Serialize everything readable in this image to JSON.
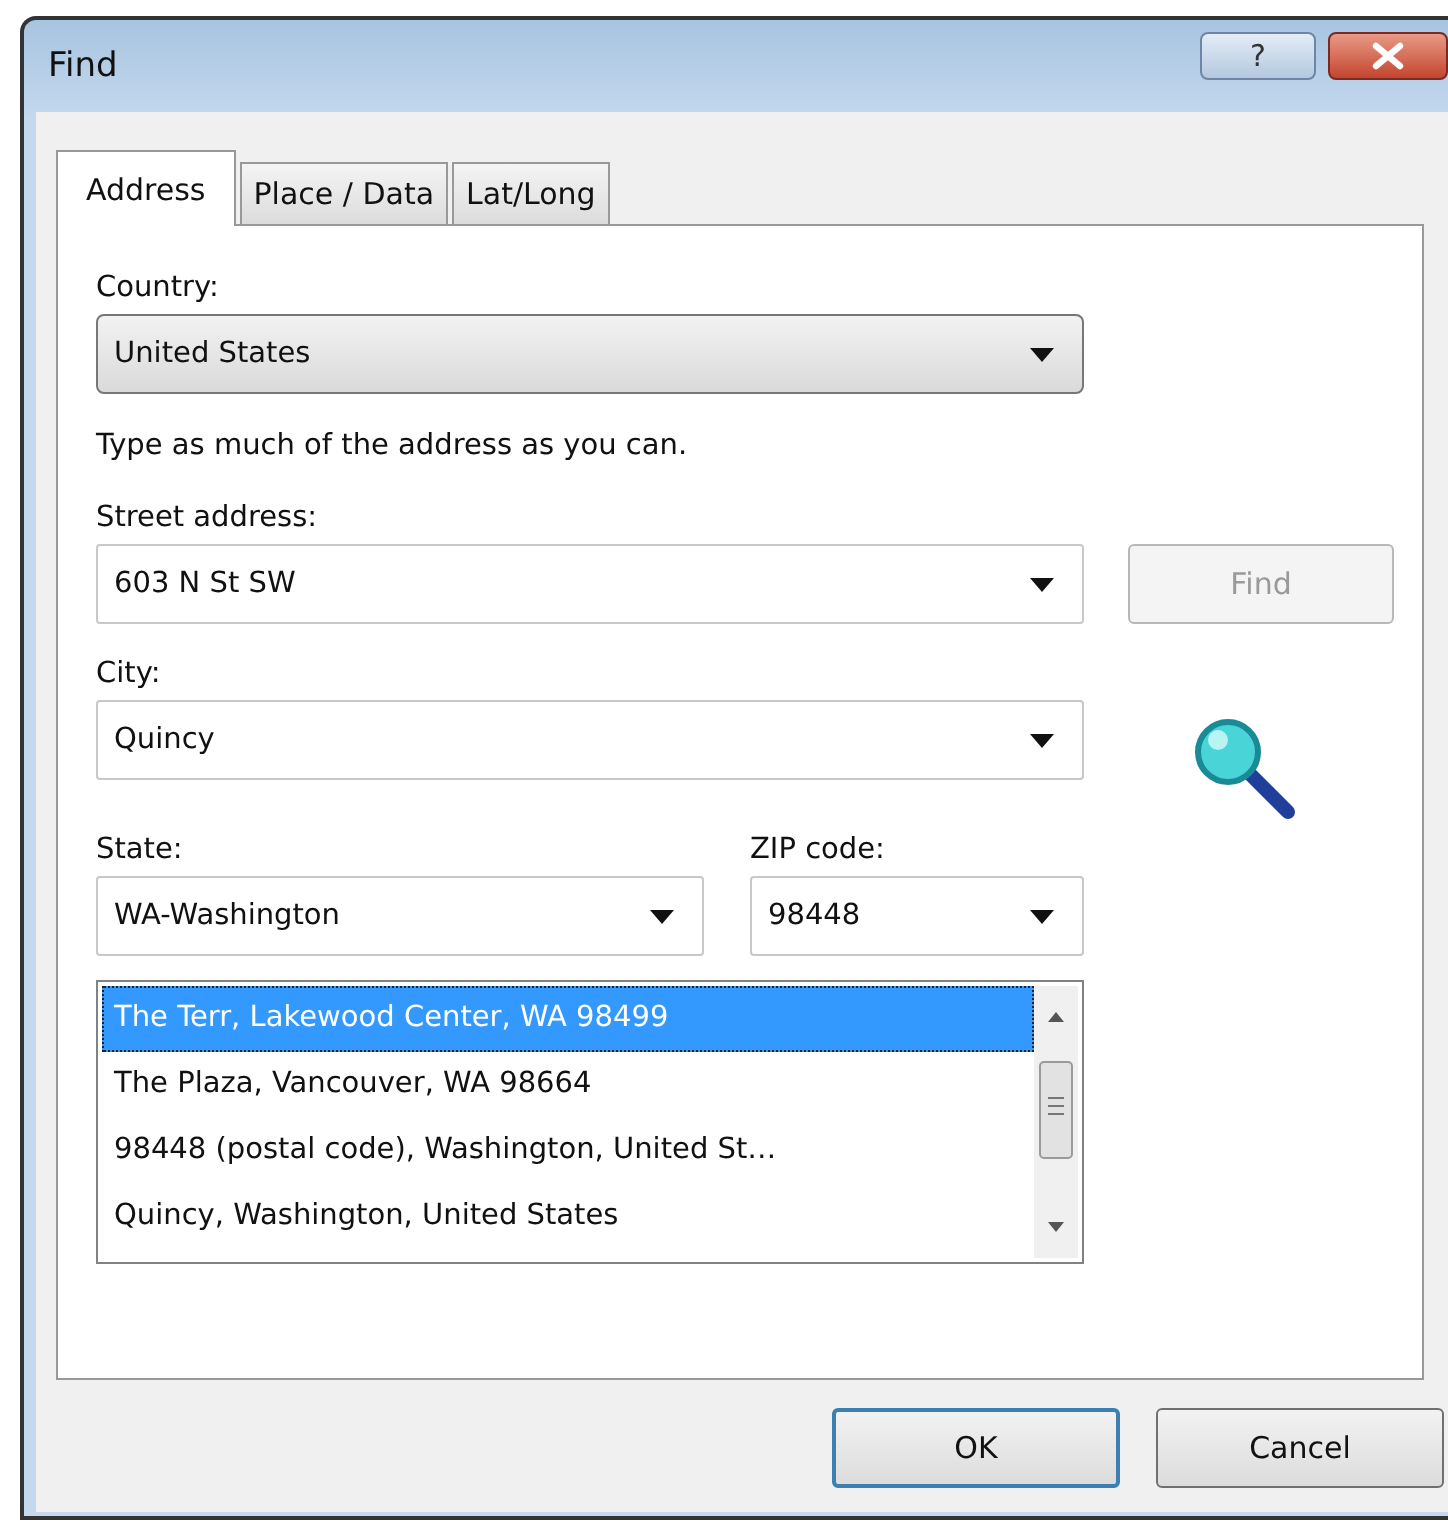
{
  "window": {
    "title": "Find",
    "help_button": "?"
  },
  "tabs": [
    {
      "label": "Address",
      "selected": true
    },
    {
      "label": "Place / Data",
      "selected": false
    },
    {
      "label": "Lat/Long",
      "selected": false
    }
  ],
  "country": {
    "label": "Country:",
    "value": "United States"
  },
  "instruction": "Type as much of the address as you can.",
  "street": {
    "label": "Street address:",
    "value": "603 N St SW"
  },
  "find_button": {
    "label": "Find",
    "disabled": true
  },
  "city": {
    "label": "City:",
    "value": "Quincy"
  },
  "state": {
    "label": "State:",
    "value": "WA-Washington"
  },
  "zip": {
    "label": "ZIP code:",
    "value": "98448"
  },
  "results": [
    {
      "text": "The Terr, Lakewood Center, WA 98499",
      "selected": true
    },
    {
      "text": "The Plaza, Vancouver, WA 98664",
      "selected": false
    },
    {
      "text": "98448 (postal code), Washington, United St…",
      "selected": false
    },
    {
      "text": "Quincy, Washington, United States",
      "selected": false
    }
  ],
  "buttons": [
    {
      "label": "OK",
      "default": true
    },
    {
      "label": "Cancel",
      "default": false
    }
  ]
}
